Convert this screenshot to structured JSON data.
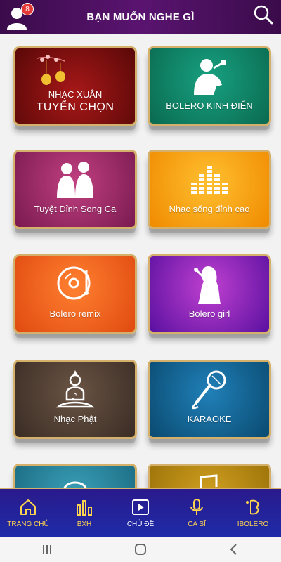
{
  "header": {
    "title": "BẠN MUỐN NGHE GÌ",
    "notification_count": "8"
  },
  "tiles": [
    {
      "label": "NHẠC XUÂN",
      "label2": "TUYỂN CHỌN",
      "color": "#8a1010",
      "icon": "lantern-icon"
    },
    {
      "label": "BOLERO KINH ĐIỂN",
      "color": "#0f8a6a",
      "icon": "singer-microphone-icon"
    },
    {
      "label": "Tuyệt Đỉnh Song Ca",
      "color": "#a0306a",
      "icon": "duet-singers-icon"
    },
    {
      "label": "Nhạc sống đỉnh cao",
      "color": "#f5a50a",
      "icon": "equalizer-icon"
    },
    {
      "label": "Bolero remix",
      "color": "#f06a20",
      "icon": "vinyl-record-icon"
    },
    {
      "label": "Bolero girl",
      "color": "#a020b0",
      "icon": "female-singer-icon"
    },
    {
      "label": "Nhạc Phật",
      "color": "#4a3a30",
      "icon": "buddha-icon"
    },
    {
      "label": "KARAOKE",
      "color": "#1a6aa0",
      "icon": "karaoke-microphone-icon"
    },
    {
      "label": "",
      "color": "#2a8aa0",
      "icon": "partial-tile-icon"
    },
    {
      "label": "",
      "color": "#b08a10",
      "icon": "partial-tile-icon"
    }
  ],
  "nav": [
    {
      "label": "TRANG CHỦ",
      "icon": "home-icon"
    },
    {
      "label": "BXH",
      "icon": "chart-bars-icon"
    },
    {
      "label": "CHỦ ĐỀ",
      "icon": "play-square-icon"
    },
    {
      "label": "CA SĨ",
      "icon": "microphone-icon"
    },
    {
      "label": "IBOLERO",
      "icon": "ibolero-logo-icon"
    }
  ]
}
